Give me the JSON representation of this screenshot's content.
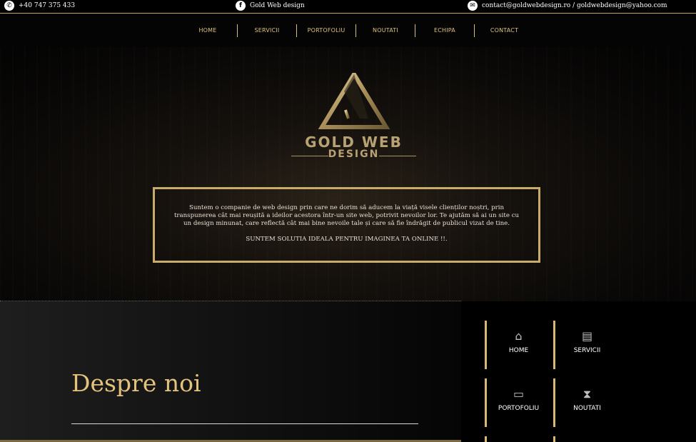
{
  "topbar": {
    "phone": "+40 747 375 433",
    "facebook": "Gold Web design",
    "email": "contact@goldwebdesign.ro  /  goldwebdesign@yahoo.com"
  },
  "nav": {
    "items": [
      "HOME",
      "SERVICII",
      "PORTOFOLIU",
      "NOUTATI",
      "ECHIPA",
      "CONTACT"
    ]
  },
  "logo": {
    "line1": "GOLD WEB",
    "line2": "DESIGN"
  },
  "intro": {
    "paragraph": "Suntem o companie de web design prin care ne dorim să aducem la viață visele clienților noștri, prin transpunerea cât mai reușită a ideilor acestora într-un site web, potrivit nevoilor lor. Te ajutăm să ai un site cu un design minunat, care reflectă cât mai bine nevoile tale și care să fie îndrăgit de publicul vizat de tine.",
    "tagline": "SUNTEM SOLUTIA IDEALA PENTRU IMAGINEA TA ONLINE !!."
  },
  "about": {
    "title": "Despre noi"
  },
  "tiles": [
    {
      "label": "HOME",
      "icon": "home-icon",
      "glyph": "⌂"
    },
    {
      "label": "SERVICII",
      "icon": "document-list-icon",
      "glyph": "▤"
    },
    {
      "label": "PORTOFOLIU",
      "icon": "folder-icon",
      "glyph": "▭"
    },
    {
      "label": "NOUTATI",
      "icon": "hourglass-icon",
      "glyph": "⧗"
    }
  ],
  "colors": {
    "accent_gold": "#d8b874",
    "background": "#000000"
  }
}
